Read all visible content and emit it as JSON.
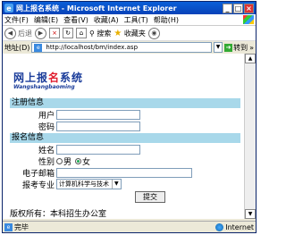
{
  "window": {
    "title": "网上报名系统 - Microsoft Internet Explorer"
  },
  "menu": [
    "文件(F)",
    "编辑(E)",
    "查看(V)",
    "收藏(A)",
    "工具(T)",
    "帮助(H)"
  ],
  "toolbar": {
    "back_label": "后退",
    "search_label": "搜索",
    "favorites_label": "收藏夹"
  },
  "address": {
    "label": "地址(D)",
    "url": "http://localhost/bm/index.asp",
    "go_label": "转到",
    "links_label": "»"
  },
  "logo": {
    "title_a": "网上报",
    "title_b": "名",
    "title_c": "系统",
    "subtitle": "Wangshangbaoming"
  },
  "login": {
    "header": "注册信息",
    "username_label": "用户",
    "password_label": "密码"
  },
  "signup": {
    "header": "报名信息",
    "name_label": "姓名",
    "gender_label": "性别",
    "gender_male": "男",
    "gender_female": "女",
    "email_label": "电子邮箱",
    "major_label": "报考专业",
    "major_value": "计算机科学与技术",
    "submit_label": "提交"
  },
  "footer": {
    "text": "版权所有：本科招生办公室"
  },
  "status": {
    "left": "完毕",
    "zone": "Internet"
  }
}
